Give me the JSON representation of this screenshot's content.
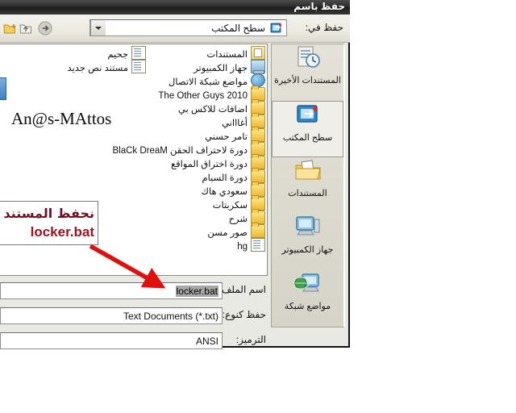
{
  "window": {
    "title": "حفظ باسم",
    "title_icon": "save-icon"
  },
  "toolbar": {
    "look_in_label": "حفظ في:",
    "look_in_value": "سطح المكتب",
    "look_in_icon": "desktop-icon",
    "dropdown_icon": "chevron-down-icon",
    "buttons": [
      {
        "name": "back-button",
        "icon": "back-arrow-icon"
      },
      {
        "name": "up-one-level-button",
        "icon": "folder-up-icon"
      },
      {
        "name": "new-folder-button",
        "icon": "new-folder-icon"
      }
    ]
  },
  "places_bar": {
    "items": [
      {
        "label": "المستندات الأخيرة",
        "icon": "recent-documents-icon",
        "selected": false
      },
      {
        "label": "سطح المكتب",
        "icon": "desktop-icon",
        "selected": true
      },
      {
        "label": "المستندات",
        "icon": "my-documents-icon",
        "selected": false
      },
      {
        "label": "جهاز الكمبيوتر",
        "icon": "my-computer-icon",
        "selected": false
      },
      {
        "label": "مواضع شبكة",
        "icon": "network-places-icon",
        "selected": false
      }
    ]
  },
  "file_list": {
    "column_right": [
      {
        "label": "المستندات",
        "icon": "my-documents-icon"
      },
      {
        "label": "جهاز الكمبيوتر",
        "icon": "my-computer-icon"
      },
      {
        "label": "مواضع شبكة الاتصال",
        "icon": "network-places-icon"
      },
      {
        "label": "The Other Guys 2010",
        "icon": "folder-icon"
      },
      {
        "label": "اضافات للاكس بي",
        "icon": "folder-icon"
      },
      {
        "label": "أغاااني",
        "icon": "folder-icon"
      },
      {
        "label": "تامر حسني",
        "icon": "folder-icon"
      },
      {
        "label": "دورة لاحتراف الحقن BlaCk DreaM",
        "icon": "folder-icon"
      },
      {
        "label": "دورة اختراق المواقع",
        "icon": "folder-icon"
      },
      {
        "label": "دورة السبام",
        "icon": "folder-icon"
      },
      {
        "label": "سعودي هاك",
        "icon": "folder-icon"
      },
      {
        "label": "سكربتات",
        "icon": "folder-icon"
      },
      {
        "label": "شرح",
        "icon": "folder-icon"
      },
      {
        "label": "صور مسن",
        "icon": "folder-icon"
      },
      {
        "label": "hg",
        "icon": "text-document-icon"
      }
    ],
    "column_left": [
      {
        "label": "جحيم",
        "icon": "text-document-icon"
      },
      {
        "label": "مستند نص جديد",
        "icon": "text-document-icon"
      }
    ]
  },
  "form": {
    "file_name": {
      "label": "اسم الملف:",
      "value": "locker.bat",
      "selected": true
    },
    "save_as_type": {
      "label": "حفظ كنوع:",
      "value": "Text Documents (*.txt)"
    },
    "encoding": {
      "label": "الترميز:",
      "value": "ANSI"
    }
  },
  "annotations": {
    "callout_line1": "نحفظ المستند ب",
    "callout_line2": "locker.bat",
    "callout_color": "#6e1022",
    "arrow_color": "#e01010",
    "watermark": "An@s-MAttos"
  }
}
